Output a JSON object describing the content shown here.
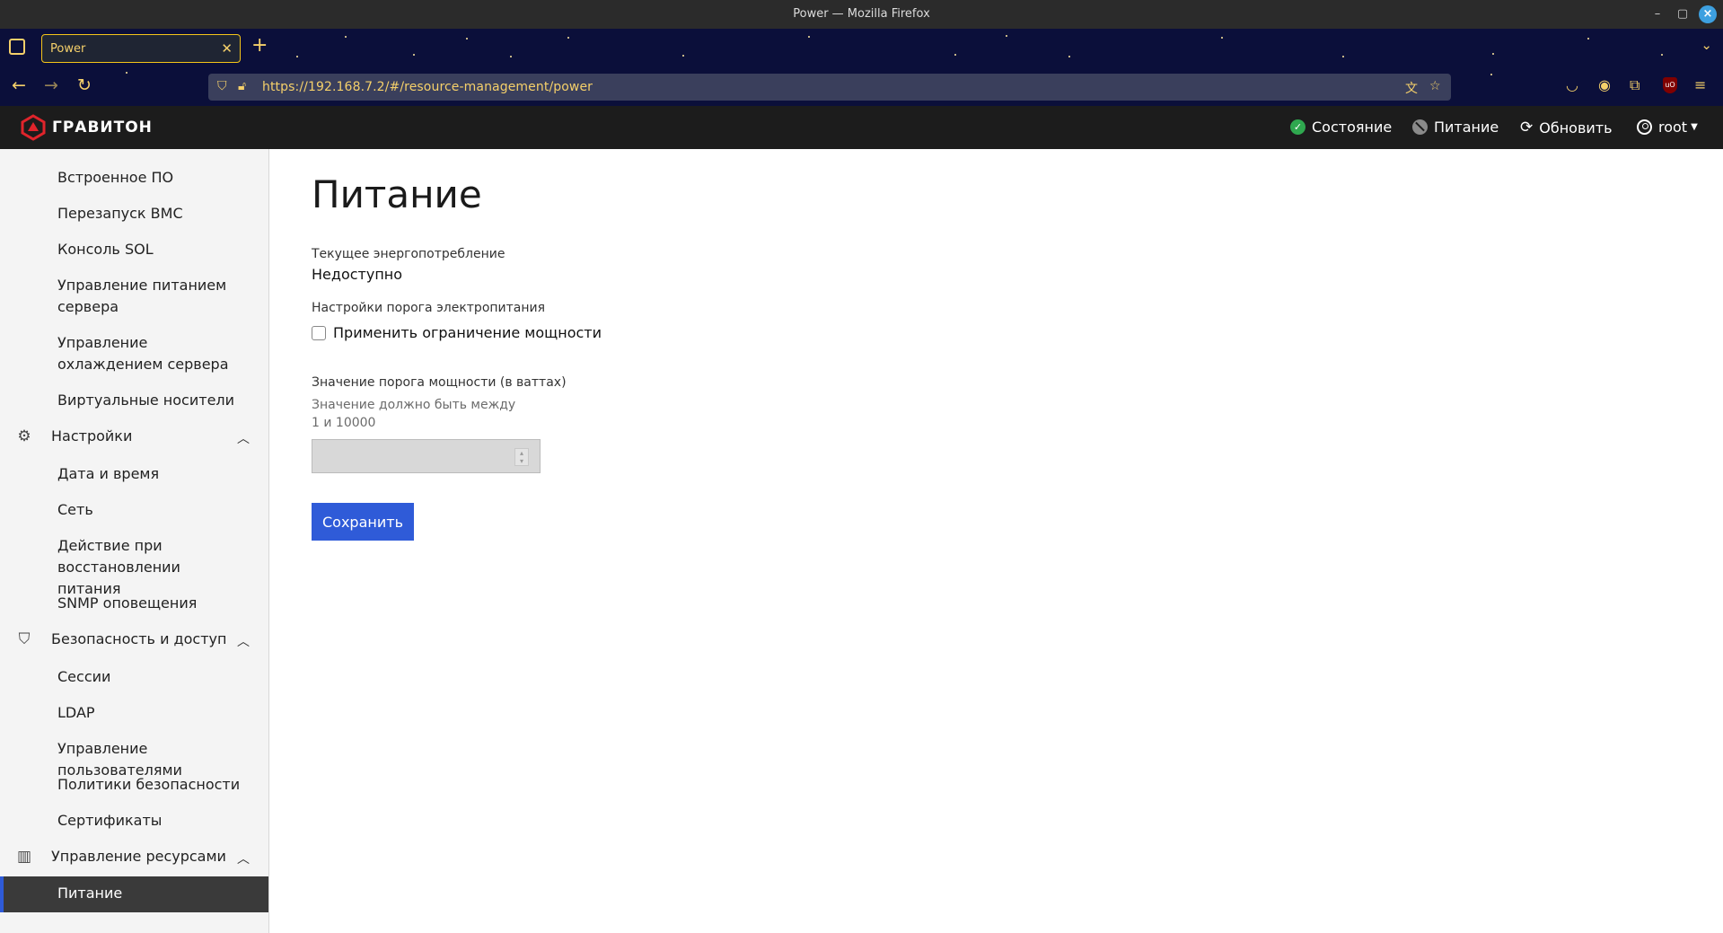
{
  "browser": {
    "window_title": "Power — Mozilla Firefox",
    "tab_title": "Power",
    "url": "https://192.168.7.2/#/resource-management/power",
    "accent": "#f5d06a"
  },
  "header": {
    "logo_text": "ГРАВИТОН",
    "status_label": "Состояние",
    "power_label": "Питание",
    "refresh_label": "Обновить",
    "user_label": "root",
    "status_color": "#2fa84f"
  },
  "sidebar": {
    "operations_items": [
      "Встроенное ПО",
      "Перезапуск BMC",
      "Консоль SOL",
      "Управление питанием сервера",
      "Управление охлаждением сервера",
      "Виртуальные носители"
    ],
    "settings": {
      "label": "Настройки",
      "items": [
        "Дата и время",
        "Сеть",
        "Действие при восстановлении питания",
        "SNMP оповещения"
      ]
    },
    "security": {
      "label": "Безопасность и доступ",
      "items": [
        "Сессии",
        "LDAP",
        "Управление пользователями",
        "Политики безопасности",
        "Сертификаты"
      ]
    },
    "resources": {
      "label": "Управление ресурсами",
      "items": [
        "Питание"
      ]
    },
    "active_color": "#2f5bd8"
  },
  "main": {
    "title": "Питание",
    "consumption_label": "Текущее энергопотребление",
    "consumption_value": "Недоступно",
    "threshold_settings_label": "Настройки порога электропитания",
    "apply_cap_label": "Применить ограничение мощности",
    "apply_cap_checked": false,
    "cap_value_label": "Значение порога мощности (в ваттах)",
    "cap_hint": "Значение должно быть между 1 и 10000",
    "cap_value": "",
    "save_label": "Сохранить",
    "button_color": "#2f5bd8"
  }
}
